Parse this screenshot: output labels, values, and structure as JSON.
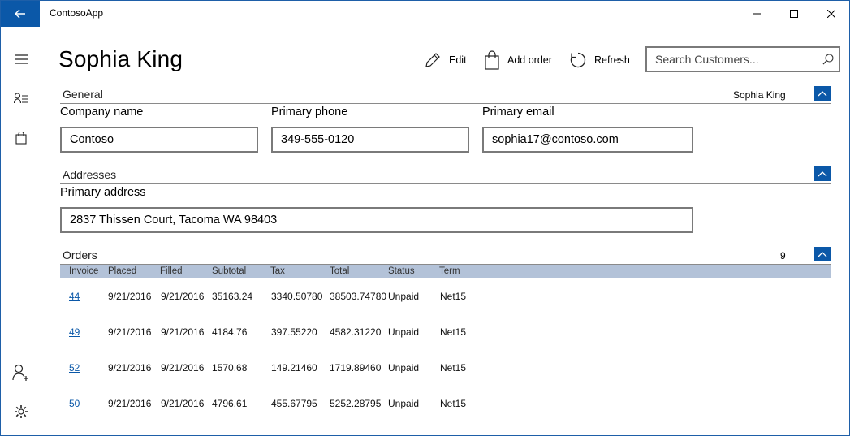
{
  "app": {
    "title": "ContosoApp"
  },
  "header": {
    "title": "Sophia King",
    "commands": {
      "edit": "Edit",
      "add_order": "Add order",
      "refresh": "Refresh"
    },
    "search": {
      "placeholder": "Search Customers..."
    }
  },
  "nav": {
    "icons": [
      "hamburger-menu-icon",
      "customer-list-icon",
      "orders-bag-icon",
      "add-user-icon",
      "settings-gear-icon"
    ]
  },
  "general": {
    "title": "General",
    "summary": "Sophia King",
    "company_label": "Company name",
    "company_value": "Contoso",
    "phone_label": "Primary phone",
    "phone_value": "349-555-0120",
    "email_label": "Primary email",
    "email_value": "sophia17@contoso.com"
  },
  "addresses": {
    "title": "Addresses",
    "primary_label": "Primary address",
    "primary_value": "2837 Thissen Court, Tacoma WA 98403"
  },
  "orders": {
    "title": "Orders",
    "count": "9",
    "columns": [
      "Invoice",
      "Placed",
      "Filled",
      "Subtotal",
      "Tax",
      "Total",
      "Status",
      "Term"
    ],
    "rows": [
      {
        "invoice": "44",
        "placed": "9/21/2016",
        "filled": "9/21/2016",
        "subtotal": "35163.24",
        "tax": "3340.50780",
        "total": "38503.74780",
        "status": "Unpaid",
        "term": "Net15"
      },
      {
        "invoice": "49",
        "placed": "9/21/2016",
        "filled": "9/21/2016",
        "subtotal": "4184.76",
        "tax": "397.55220",
        "total": "4582.31220",
        "status": "Unpaid",
        "term": "Net15"
      },
      {
        "invoice": "52",
        "placed": "9/21/2016",
        "filled": "9/21/2016",
        "subtotal": "1570.68",
        "tax": "149.21460",
        "total": "1719.89460",
        "status": "Unpaid",
        "term": "Net15"
      },
      {
        "invoice": "50",
        "placed": "9/21/2016",
        "filled": "9/21/2016",
        "subtotal": "4796.61",
        "tax": "455.67795",
        "total": "5252.28795",
        "status": "Unpaid",
        "term": "Net15"
      }
    ]
  },
  "colors": {
    "accent": "#0b58a8",
    "grid_header": "#b3c2d8",
    "border": "#7a7a7a"
  }
}
